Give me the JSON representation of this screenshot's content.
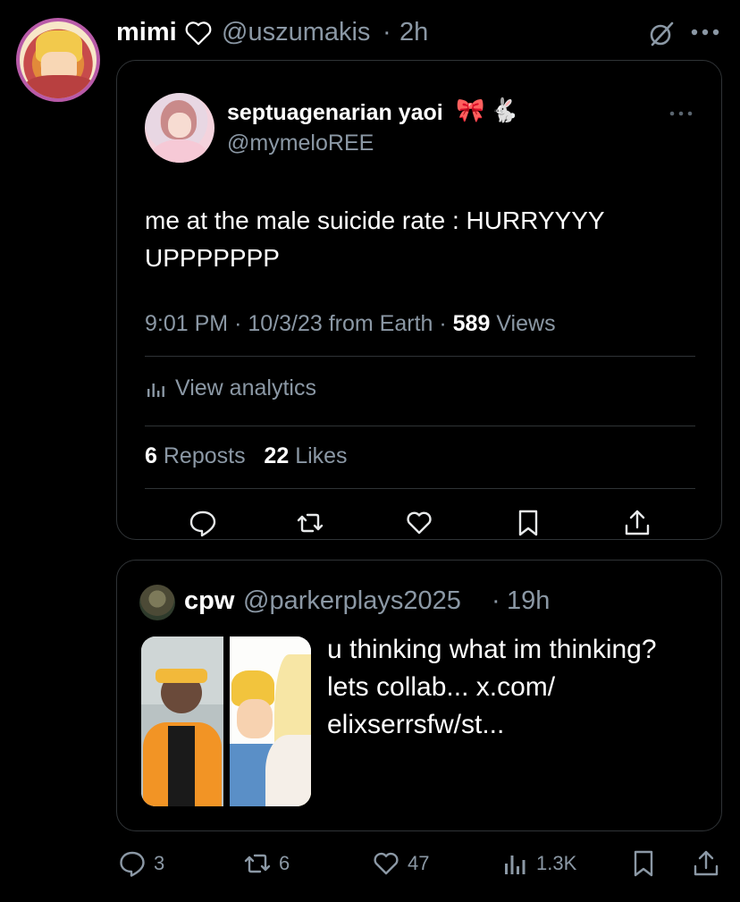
{
  "header": {
    "display_name": "mimi",
    "handle": "@uszumakis",
    "separator": "·",
    "time": "2h"
  },
  "quoted_tweet": {
    "name": "septuagenarian yaoi",
    "emoji_1": "🎀",
    "emoji_2": "🐇",
    "handle": "@mymeloREE",
    "text": "me at the male suicide rate : HURRYYYY UPPPPPPP",
    "meta": {
      "time": "9:01 PM",
      "sep": "·",
      "date": "10/3/23",
      "source": "from Earth",
      "views_count": "589",
      "views_label": "Views"
    },
    "analytics_label": "View analytics",
    "reposts_count": "6",
    "reposts_label": "Reposts",
    "likes_count": "22",
    "likes_label": "Likes"
  },
  "quote_card": {
    "name": "cpw",
    "handle": "@parkerplays2025",
    "separator": "·",
    "time": "19h",
    "text": "u thinking what im thinking? lets collab... x.com/ elixserrsfw/st..."
  },
  "actions": {
    "replies": "3",
    "reposts": "6",
    "likes": "47",
    "views": "1.3K"
  },
  "colors": {
    "background": "#000000",
    "text": "#e7e9ea",
    "muted": "#8b98a5",
    "border": "#2f3336",
    "avatar_ring": "#b85aa8"
  }
}
